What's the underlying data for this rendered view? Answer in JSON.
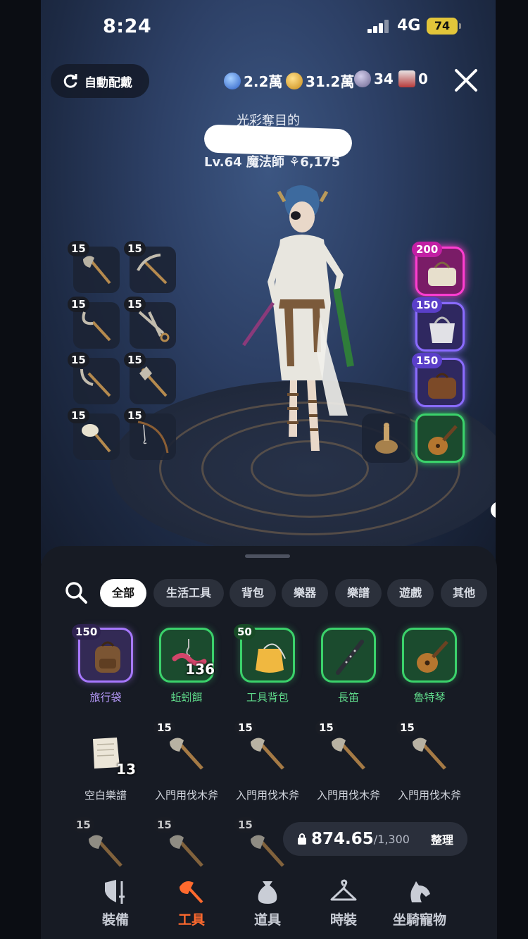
{
  "status_bar": {
    "time": "8:24",
    "network": "4G",
    "battery": "74"
  },
  "top": {
    "auto_equip_label": "自動配戴",
    "currencies": [
      {
        "icon": "blue-gem-icon",
        "value": "2.2萬",
        "color": "#4d8ef0"
      },
      {
        "icon": "gold-coin-icon",
        "value": "31.2萬",
        "color": "#e8b43a"
      },
      {
        "icon": "purple-coin-icon",
        "value": "34",
        "color": "#8f86b5"
      },
      {
        "icon": "red-crest-icon",
        "value": "0",
        "color": "#c24848"
      }
    ]
  },
  "character": {
    "title": "光彩奪目的",
    "level_line": "Lv.64 魔法師 ⚘6,175"
  },
  "tool_slots": [
    "15",
    "15",
    "15",
    "15",
    "15",
    "15",
    "15",
    "15"
  ],
  "equip_slots": [
    {
      "badge": "200",
      "icon": "handbag-icon"
    },
    {
      "badge": "150",
      "icon": "tote-bag-icon"
    },
    {
      "badge": "150",
      "icon": "travel-bag-icon"
    }
  ],
  "filters": [
    "全部",
    "生活工具",
    "背包",
    "樂器",
    "樂譜",
    "遊戲",
    "其他"
  ],
  "items": [
    {
      "name": "旅行袋",
      "badge": "150",
      "count": "",
      "rarity": "purple",
      "name_color": "#b99cff"
    },
    {
      "name": "蚯蚓餌",
      "badge": "",
      "count": "136",
      "rarity": "green",
      "name_color": "#5fd98a"
    },
    {
      "name": "工具背包",
      "badge": "50",
      "count": "",
      "rarity": "green",
      "name_color": "#5fd98a"
    },
    {
      "name": "長笛",
      "badge": "",
      "count": "",
      "rarity": "green",
      "name_color": "#5fd98a"
    },
    {
      "name": "魯特琴",
      "badge": "",
      "count": "",
      "rarity": "green",
      "name_color": "#5fd98a"
    },
    {
      "name": "空白樂譜",
      "badge": "",
      "count": "13",
      "rarity": "plain",
      "name_color": "#d0d4dc"
    },
    {
      "name": "入門用伐木斧",
      "badge": "15",
      "count": "",
      "rarity": "plain",
      "name_color": "#d0d4dc"
    },
    {
      "name": "入門用伐木斧",
      "badge": "15",
      "count": "",
      "rarity": "plain",
      "name_color": "#d0d4dc"
    },
    {
      "name": "入門用伐木斧",
      "badge": "15",
      "count": "",
      "rarity": "plain",
      "name_color": "#d0d4dc"
    },
    {
      "name": "入門用伐木斧",
      "badge": "15",
      "count": "",
      "rarity": "plain",
      "name_color": "#d0d4dc"
    },
    {
      "name": "",
      "badge": "15",
      "count": "",
      "rarity": "plain",
      "name_color": "#d0d4dc"
    },
    {
      "name": "",
      "badge": "15",
      "count": "",
      "rarity": "plain",
      "name_color": "#d0d4dc"
    },
    {
      "name": "",
      "badge": "15",
      "count": "",
      "rarity": "plain",
      "name_color": "#d0d4dc"
    }
  ],
  "weight": {
    "current": "874.65",
    "max": "/1,300",
    "sort_label": "整理"
  },
  "nav": [
    "裝備",
    "工具",
    "道具",
    "時裝",
    "坐騎寵物"
  ]
}
